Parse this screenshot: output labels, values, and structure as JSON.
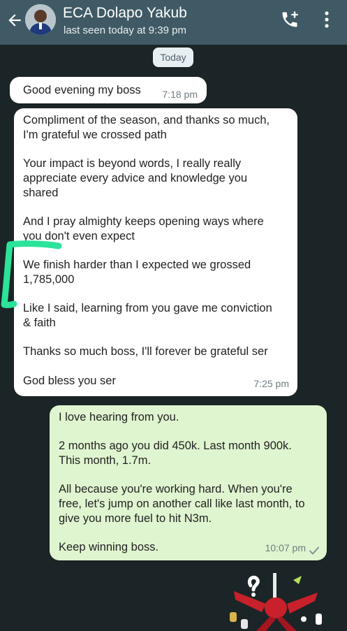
{
  "header": {
    "contact_name": "ECA Dolapo Yakub",
    "status": "last seen today at 9:39 pm"
  },
  "date_chip": "Today",
  "messages": [
    {
      "direction": "incoming",
      "paragraphs": [
        "Good evening my boss"
      ],
      "time": "7:18 pm"
    },
    {
      "direction": "incoming",
      "paragraphs": [
        "Compliment of the season, and thanks so much,\nI'm grateful we crossed path",
        "Your impact is beyond words, I really really\nappreciate every advice and knowledge you\nshared",
        "And I pray almighty keeps opening ways where\nyou don't even expect",
        "We finish harder than I expected we grossed\n1,785,000",
        "Like I said, learning from you gave me conviction\n& faith",
        "Thanks so much boss, I'll forever be grateful ser",
        "God bless you ser"
      ],
      "time": "7:25 pm"
    },
    {
      "direction": "outgoing",
      "paragraphs": [
        "I love hearing from you.",
        "2 months ago you did 450k. Last month 900k.\nThis month, 1.7m.",
        "All because you're working hard. When you're\nfree, let's jump on another call like last month, to\ngive you more fuel to hit N3m.",
        "Keep winning boss."
      ],
      "time": "10:07 pm",
      "status_icon": "single-check-icon"
    }
  ],
  "colors": {
    "header_bg": "#3f5a64",
    "chat_bg": "#1b2426",
    "incoming_bubble": "#ffffff",
    "outgoing_bubble": "#dff5cf",
    "annotation": "#2be39a"
  },
  "icons": [
    "back-arrow-icon",
    "add-call-icon",
    "more-vert-icon",
    "single-check-icon"
  ]
}
